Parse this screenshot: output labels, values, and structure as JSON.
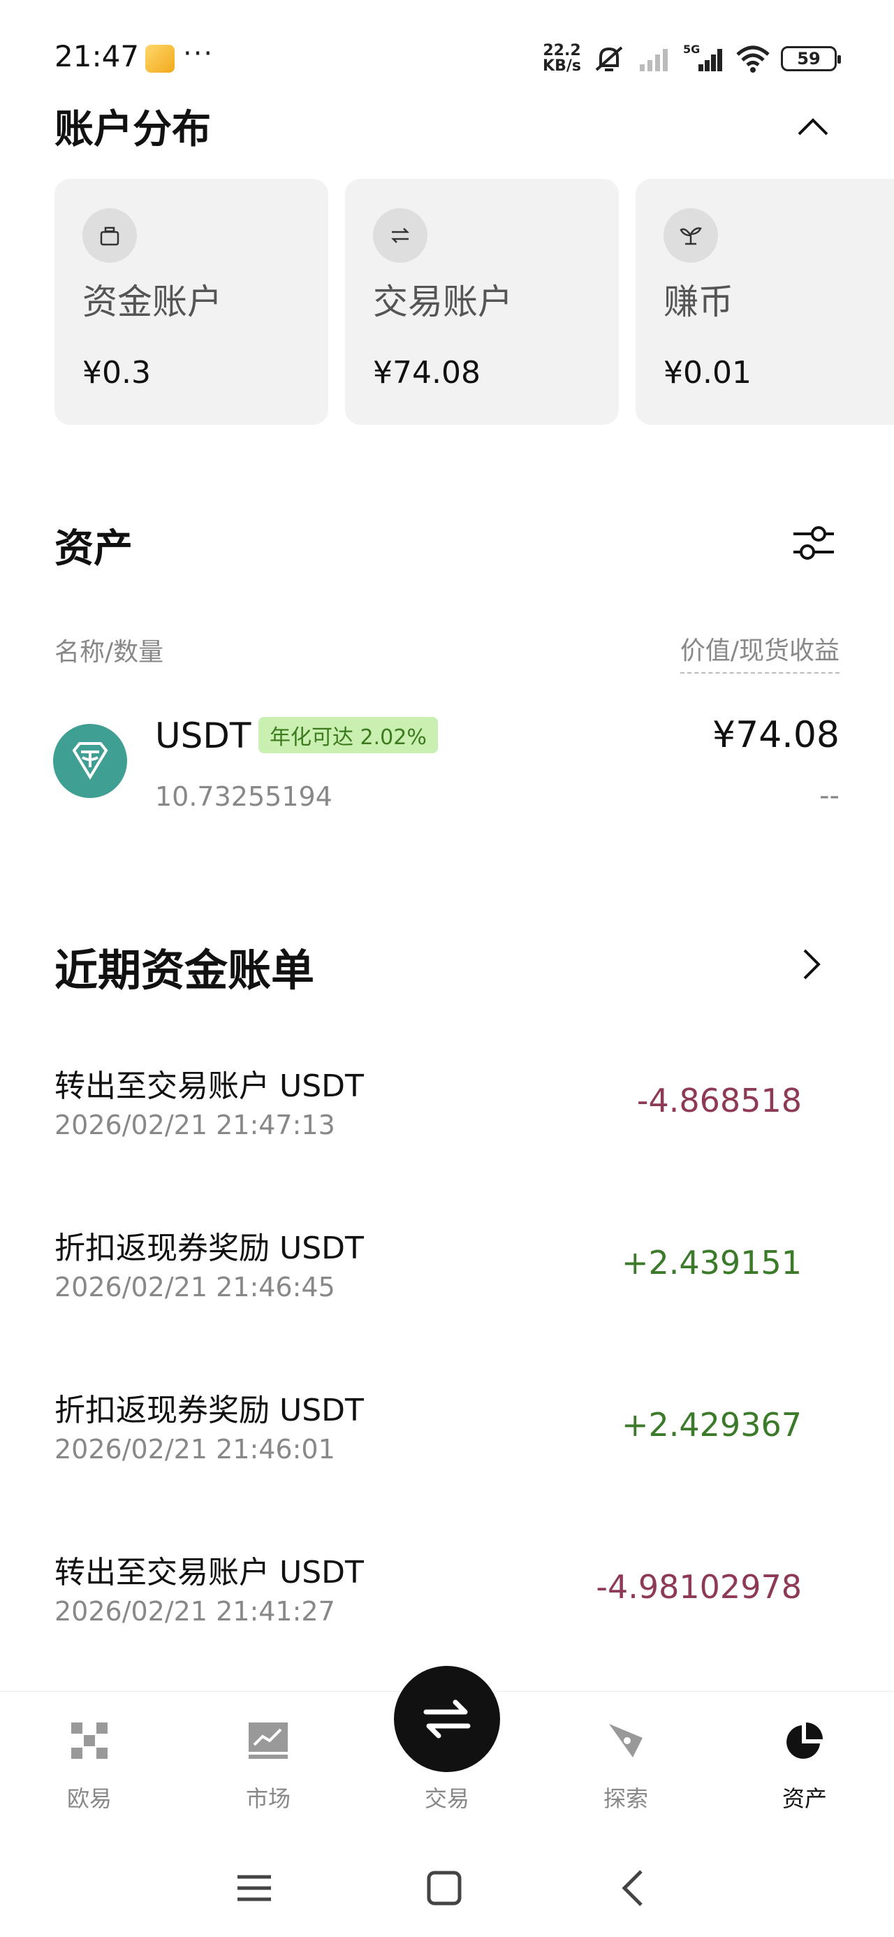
{
  "status_bar": {
    "time": "21:47",
    "more": "···",
    "net_speed_value": "22.2",
    "net_speed_unit": "KB/s",
    "network": "5G",
    "battery": "59"
  },
  "account_distribution": {
    "title": "账户分布",
    "cards": [
      {
        "label": "资金账户",
        "value": "¥0.3",
        "icon": "wallet-icon"
      },
      {
        "label": "交易账户",
        "value": "¥74.08",
        "icon": "swap-icon"
      },
      {
        "label": "赚币",
        "value": "¥0.01",
        "icon": "sprout-icon"
      }
    ]
  },
  "assets": {
    "title": "资产",
    "col_left": "名称/数量",
    "col_right": "价值/现货收益",
    "items": [
      {
        "symbol": "USDT",
        "badge": "年化可达 2.02%",
        "amount": "10.73255194",
        "value": "¥74.08",
        "pnl": "--"
      }
    ]
  },
  "bills": {
    "title": "近期资金账单",
    "items": [
      {
        "title": "转出至交易账户 USDT",
        "time": "2026/02/21 21:47:13",
        "amount": "-4.868518",
        "sign": "neg"
      },
      {
        "title": "折扣返现券奖励 USDT",
        "time": "2026/02/21 21:46:45",
        "amount": "+2.439151",
        "sign": "pos"
      },
      {
        "title": "折扣返现券奖励 USDT",
        "time": "2026/02/21 21:46:01",
        "amount": "+2.429367",
        "sign": "pos"
      },
      {
        "title": "转出至交易账户 USDT",
        "time": "2026/02/21 21:41:27",
        "amount": "-4.98102978",
        "sign": "neg"
      }
    ]
  },
  "nav": {
    "items": [
      {
        "label": "欧易",
        "icon": "okx-logo-icon"
      },
      {
        "label": "市场",
        "icon": "market-chart-icon"
      },
      {
        "label": "交易",
        "icon": "trade-swap-icon"
      },
      {
        "label": "探索",
        "icon": "explore-compass-icon"
      },
      {
        "label": "资产",
        "icon": "assets-pie-icon",
        "active": true
      }
    ]
  },
  "colors": {
    "negative": "#8e3a55",
    "positive": "#3b7a28",
    "usdt": "#3f9f93",
    "badge_bg": "#c9efb1"
  }
}
